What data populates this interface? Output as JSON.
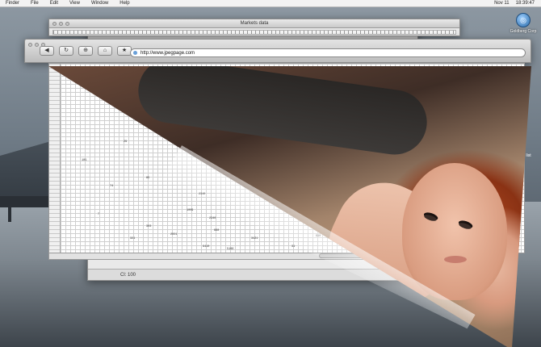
{
  "menubar": {
    "items": [
      "Finder",
      "File",
      "Edit",
      "View",
      "Window",
      "Help"
    ],
    "date": "Nov 11",
    "time": "18:39:47"
  },
  "desktop": {
    "icon_label": "Goldberg Corp",
    "icon_glyph": "◎",
    "side_label": "rs list"
  },
  "markets_window": {
    "title": "Markets data"
  },
  "back_window": {
    "footer_text": "Cl: 100"
  },
  "browser": {
    "url": "http://www.jpegpage.com",
    "buttons": [
      "◀",
      "↻",
      "⊕",
      "⌂",
      "★"
    ]
  },
  "sheet": {
    "cells": [
      "101",
      "29",
      "85",
      "1011",
      "2340",
      "2340",
      "888",
      "1471",
      "7",
      "303",
      "3421",
      "31",
      "9410",
      "5180",
      "1009",
      "2021",
      "321",
      "74",
      "910",
      "44",
      "11"
    ]
  },
  "colors": {
    "menubar_bg": "#f2f2f2",
    "hair": "#b34a22",
    "desktop_bg": "#6f7b86"
  }
}
